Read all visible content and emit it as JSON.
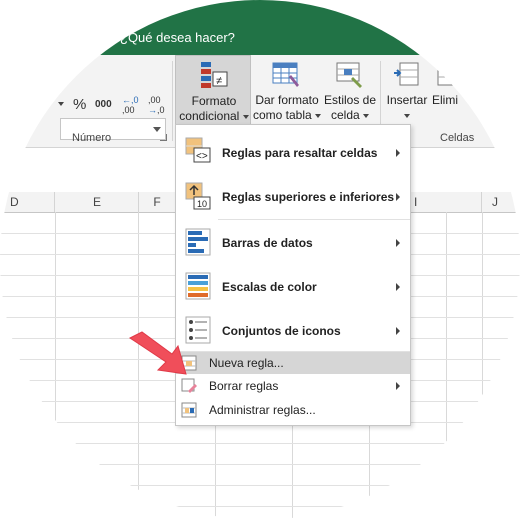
{
  "tell_me": {
    "text": "¿Qué desea hacer?"
  },
  "ribbon": {
    "number_group_label": "Número",
    "cells_group_label": "Celdas",
    "percent_symbol": "%",
    "thousands_symbol": "000",
    "decrease_decimal_symbol": ",0",
    "increase_decimal_symbol": ",00",
    "conditional_format": {
      "line1": "Formato",
      "line2": "condicional"
    },
    "format_as_table": {
      "line1": "Dar formato",
      "line2": "como tabla"
    },
    "cell_styles": {
      "line1": "Estilos de",
      "line2": "celda"
    },
    "insert": {
      "label": "Insertar"
    },
    "delete": {
      "label": "Elimi"
    }
  },
  "grid": {
    "columns": [
      "D",
      "E",
      "F",
      "I",
      "J"
    ]
  },
  "menu": {
    "items": [
      {
        "label": "Reglas para resaltar celdas",
        "mnemonic": "R",
        "has_submenu": true
      },
      {
        "label": "Reglas superiores e inferiores",
        "mnemonic": "R",
        "has_submenu": true
      },
      {
        "label": "Barras de datos",
        "mnemonic": "B",
        "has_submenu": true
      },
      {
        "label": "Escalas de color",
        "mnemonic": "E",
        "has_submenu": true
      },
      {
        "label": "Conjuntos de iconos",
        "mnemonic": "C",
        "has_submenu": true
      },
      {
        "label": "Nueva regla...",
        "mnemonic": "N",
        "has_submenu": false,
        "highlighted": true
      },
      {
        "label": "Borrar reglas",
        "mnemonic": "B",
        "has_submenu": true
      },
      {
        "label": "Administrar reglas...",
        "mnemonic": "A",
        "has_submenu": false
      }
    ]
  },
  "colors": {
    "excel_green": "#217346",
    "arrow_red": "#f04e5a",
    "highlight": "#d6d6d6"
  }
}
